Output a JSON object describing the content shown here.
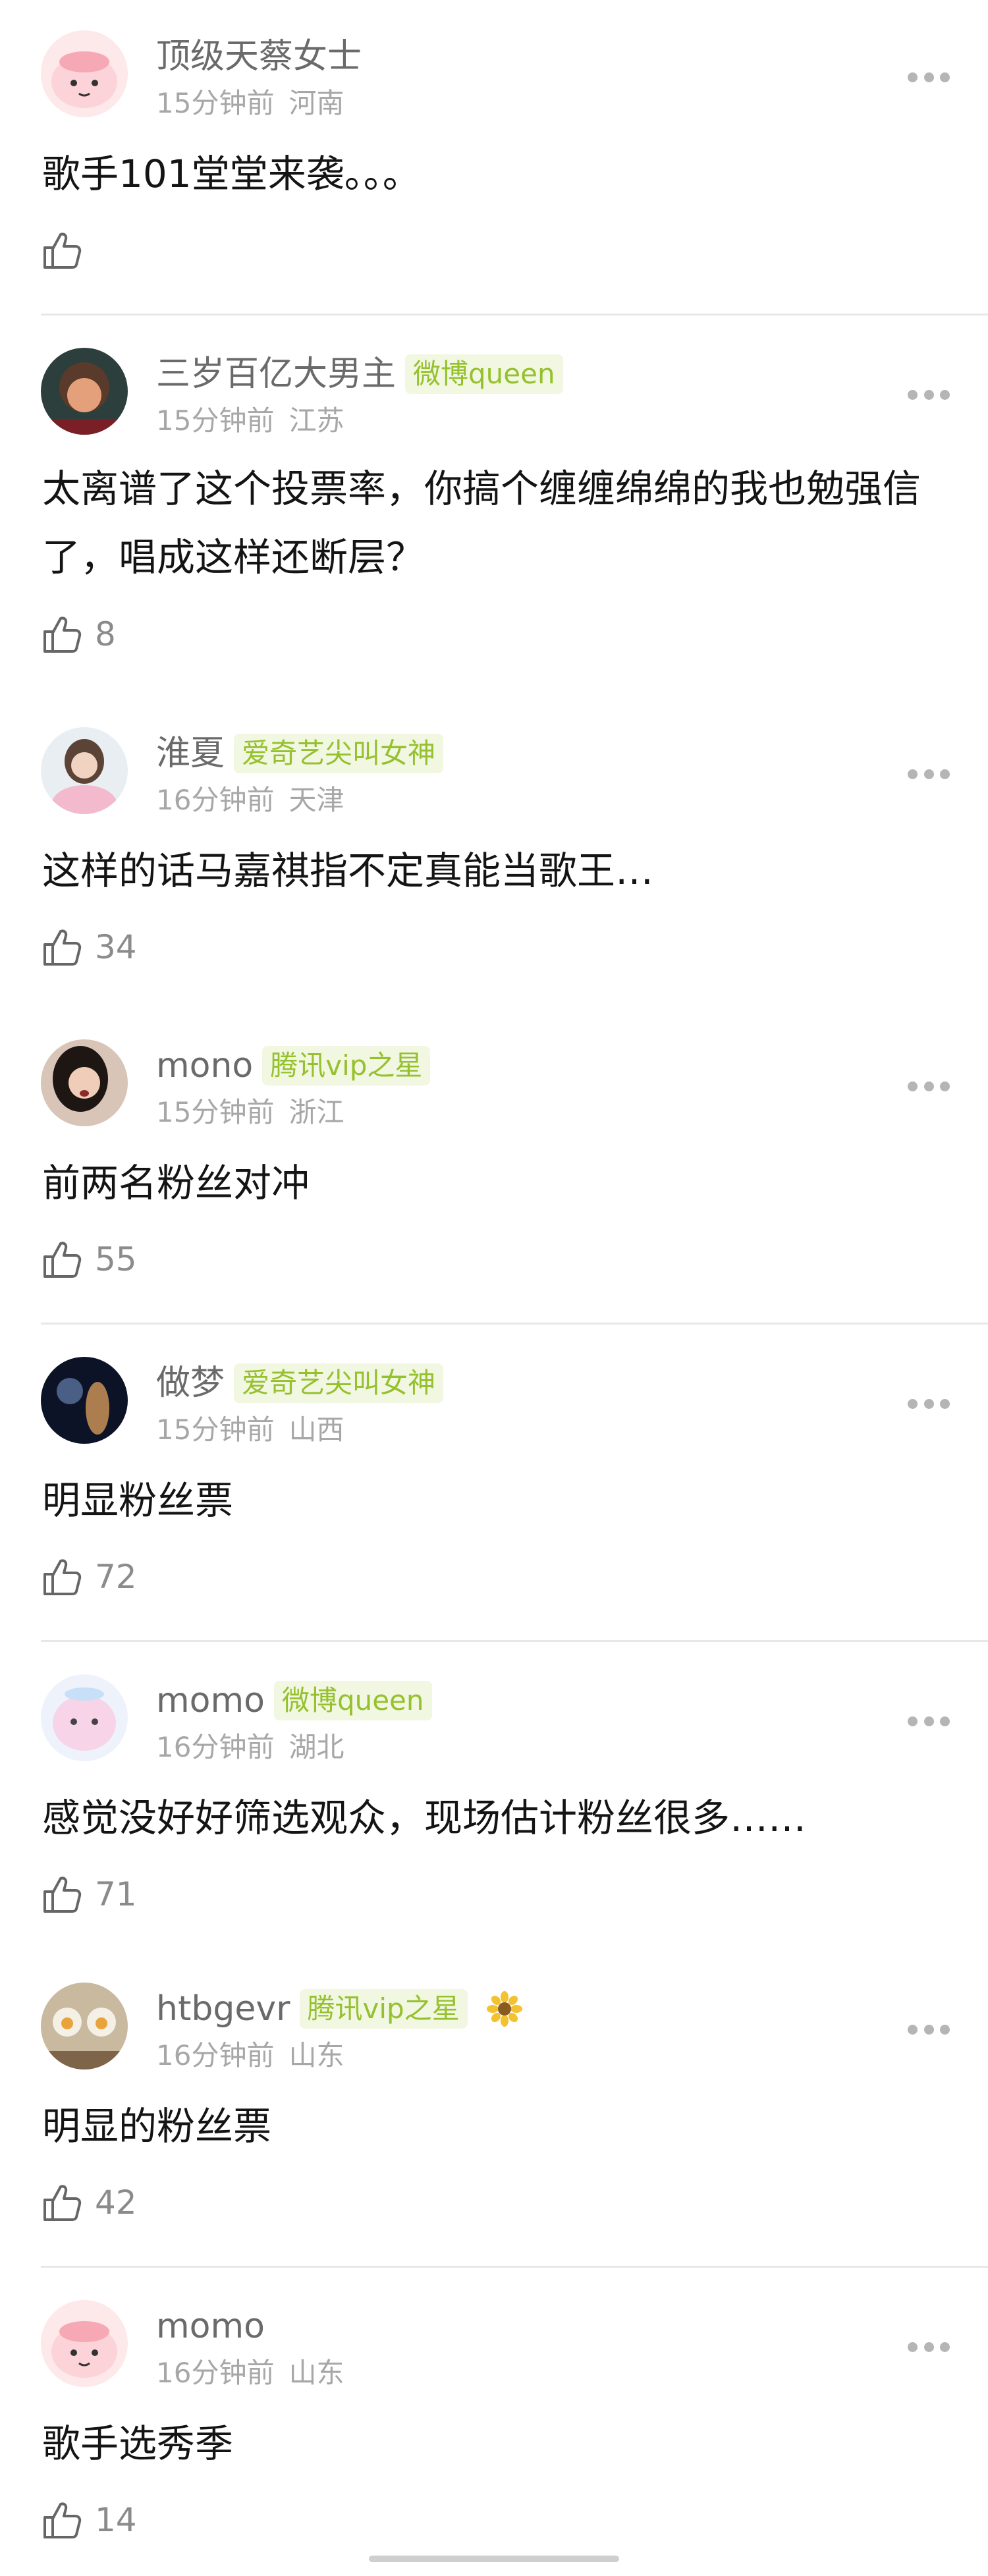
{
  "comments": [
    {
      "username": "顶级天蔡女士",
      "badge": "",
      "time": "15分钟前",
      "location": "河南",
      "text": "歌手101堂堂来袭。。。",
      "likes": "",
      "avatar_icon": "pink-blob-avatar"
    },
    {
      "username": "三岁百亿大男主",
      "badge": "微博queen",
      "time": "15分钟前",
      "location": "江苏",
      "text": "太离谱了这个投票率，你搞个缠缠绵绵的我也勉强信了，唱成这样还断层？",
      "likes": "8",
      "avatar_icon": "cartoon-girl-avatar"
    },
    {
      "username": "淮夏",
      "badge": "爱奇艺尖叫女神",
      "time": "16分钟前",
      "location": "天津",
      "text": "这样的话马嘉祺指不定真能当歌王…",
      "likes": "34",
      "avatar_icon": "girl-photo-avatar"
    },
    {
      "username": "mono",
      "badge": "腾讯vip之星",
      "time": "15分钟前",
      "location": "浙江",
      "text": "前两名粉丝对冲",
      "likes": "55",
      "avatar_icon": "woman-photo-avatar"
    },
    {
      "username": "做梦",
      "badge": "爱奇艺尖叫女神",
      "time": "15分钟前",
      "location": "山西",
      "text": "明显粉丝票",
      "likes": "72",
      "avatar_icon": "dark-figure-avatar"
    },
    {
      "username": "momo",
      "badge": "微博queen",
      "time": "16分钟前",
      "location": "湖北",
      "text": "感觉没好好筛选观众，现场估计粉丝很多……",
      "likes": "71",
      "avatar_icon": "pastel-creature-avatar"
    },
    {
      "username": "htbgevr",
      "badge": "腾讯vip之星",
      "time": "16分钟前",
      "location": "山东",
      "text": "明显的粉丝票",
      "likes": "42",
      "avatar_icon": "food-photo-avatar",
      "extra_icon": "sunflower-icon"
    },
    {
      "username": "momo",
      "badge": "",
      "time": "16分钟前",
      "location": "山东",
      "text": "歌手选秀季",
      "likes": "14",
      "avatar_icon": "pink-blob-avatar"
    }
  ],
  "colors": {
    "badge_text": "#96c12e",
    "badge_bg": "#f1f7e1",
    "username": "#6a6a6a",
    "meta": "#a7a7a7"
  }
}
